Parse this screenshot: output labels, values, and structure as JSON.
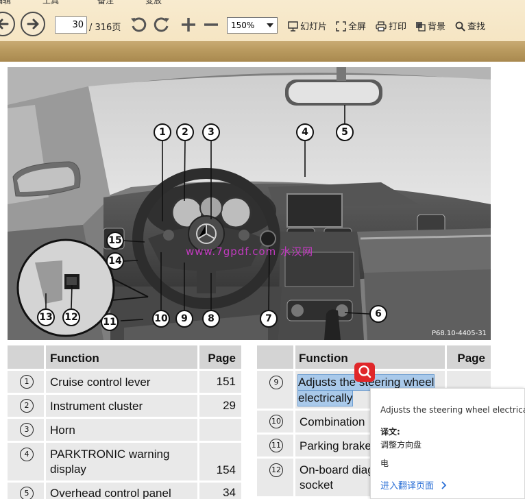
{
  "menu": {
    "tabs": [
      "编辑",
      "工具",
      "备注",
      "变放"
    ]
  },
  "toolbar": {
    "page_current": "30",
    "page_total": "/ 316页",
    "zoom": "150%",
    "slideshow": "幻灯片",
    "fullscreen": "全屏",
    "print": "打印",
    "background": "背景",
    "find": "查找",
    "icons": {
      "back": "arrow-left-icon",
      "forward": "arrow-right-icon",
      "rotate_left": "rotate-ccw-icon",
      "rotate_right": "rotate-cw-icon",
      "zoom_in": "plus-icon",
      "zoom_out": "minus-icon"
    }
  },
  "figure": {
    "callouts": [
      "1",
      "2",
      "3",
      "4",
      "5",
      "6",
      "7",
      "8",
      "9",
      "10",
      "11",
      "12",
      "13",
      "14",
      "15"
    ],
    "figure_id": "P68.10-4405-31",
    "watermark": "www.7gpdf.com 水汉网"
  },
  "table_left": {
    "header": {
      "function": "Function",
      "page": "Page"
    },
    "rows": [
      {
        "num": "1",
        "function": "Cruise control lever",
        "page": "151"
      },
      {
        "num": "2",
        "function": "Instrument cluster",
        "page": "29"
      },
      {
        "num": "3",
        "function": "Horn",
        "page": ""
      },
      {
        "num": "4",
        "function_line1": "PARKTRONIC warning",
        "function_line2": "display",
        "page": "154"
      },
      {
        "num": "5",
        "function": "Overhead control panel",
        "page": "34"
      }
    ]
  },
  "table_right": {
    "header": {
      "function": "Function",
      "page": "Page"
    },
    "rows": [
      {
        "num": "9",
        "function_line1": "Adjusts the steering wheel",
        "function_line2": "electrically",
        "page": ""
      },
      {
        "num": "10",
        "function": "Combination",
        "page": ""
      },
      {
        "num": "11",
        "function": "Parking brake",
        "page": ""
      },
      {
        "num": "12",
        "function_line1": "On-board diag",
        "function_line2": "socket",
        "page": ""
      }
    ]
  },
  "translate_popup": {
    "source": "Adjusts the steering wheel electrically",
    "label": "译文:",
    "line1": "调整方向盘",
    "line2": "电",
    "link": "进入翻译页面"
  },
  "colors": {
    "toolbar_bg": "#f4e2bd",
    "toolbar_bar": "#b99a5f",
    "table_header": "#d4d4d4",
    "table_row": "#e9e9e9",
    "selection": "#a9c9ea",
    "search_fab": "#e0272a",
    "link": "#2a6fd6"
  }
}
